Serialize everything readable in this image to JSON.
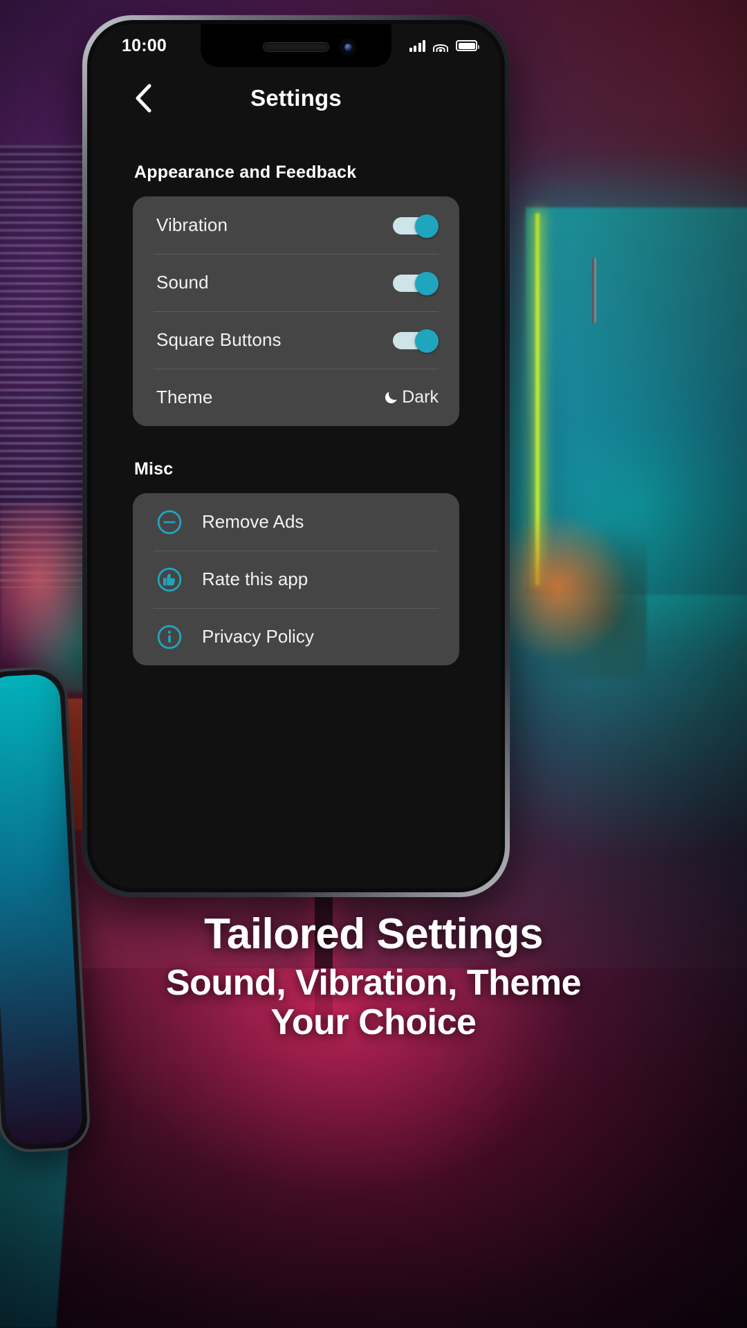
{
  "statusbar": {
    "clock": "10:00",
    "icons": [
      "cellular-signal-icon",
      "wifi-icon",
      "battery-icon"
    ]
  },
  "appbar": {
    "back_icon": "chevron-left-icon",
    "title": "Settings"
  },
  "sections": [
    {
      "title": "Appearance and Feedback",
      "rows": [
        {
          "label": "Vibration",
          "control": "toggle",
          "value": "on"
        },
        {
          "label": "Sound",
          "control": "toggle",
          "value": "on"
        },
        {
          "label": "Square Buttons",
          "control": "toggle",
          "value": "on"
        },
        {
          "label": "Theme",
          "control": "value",
          "value": "Dark",
          "icon": "moon-icon"
        }
      ]
    },
    {
      "title": "Misc",
      "rows": [
        {
          "label": "Remove Ads",
          "icon": "minus-circle-icon"
        },
        {
          "label": "Rate this app",
          "icon": "thumbs-up-circle-icon"
        },
        {
          "label": "Privacy Policy",
          "icon": "info-circle-icon"
        }
      ]
    }
  ],
  "caption": {
    "line1": "Tailored Settings",
    "line2": "Sound, Vibration, Theme",
    "line3": "Your Choice"
  },
  "colors": {
    "accent": "#1fa5bd",
    "toggle_track": "#cfe4e8",
    "card": "#454545",
    "screen_bg": "#111111",
    "text": "#f2f2f2"
  }
}
